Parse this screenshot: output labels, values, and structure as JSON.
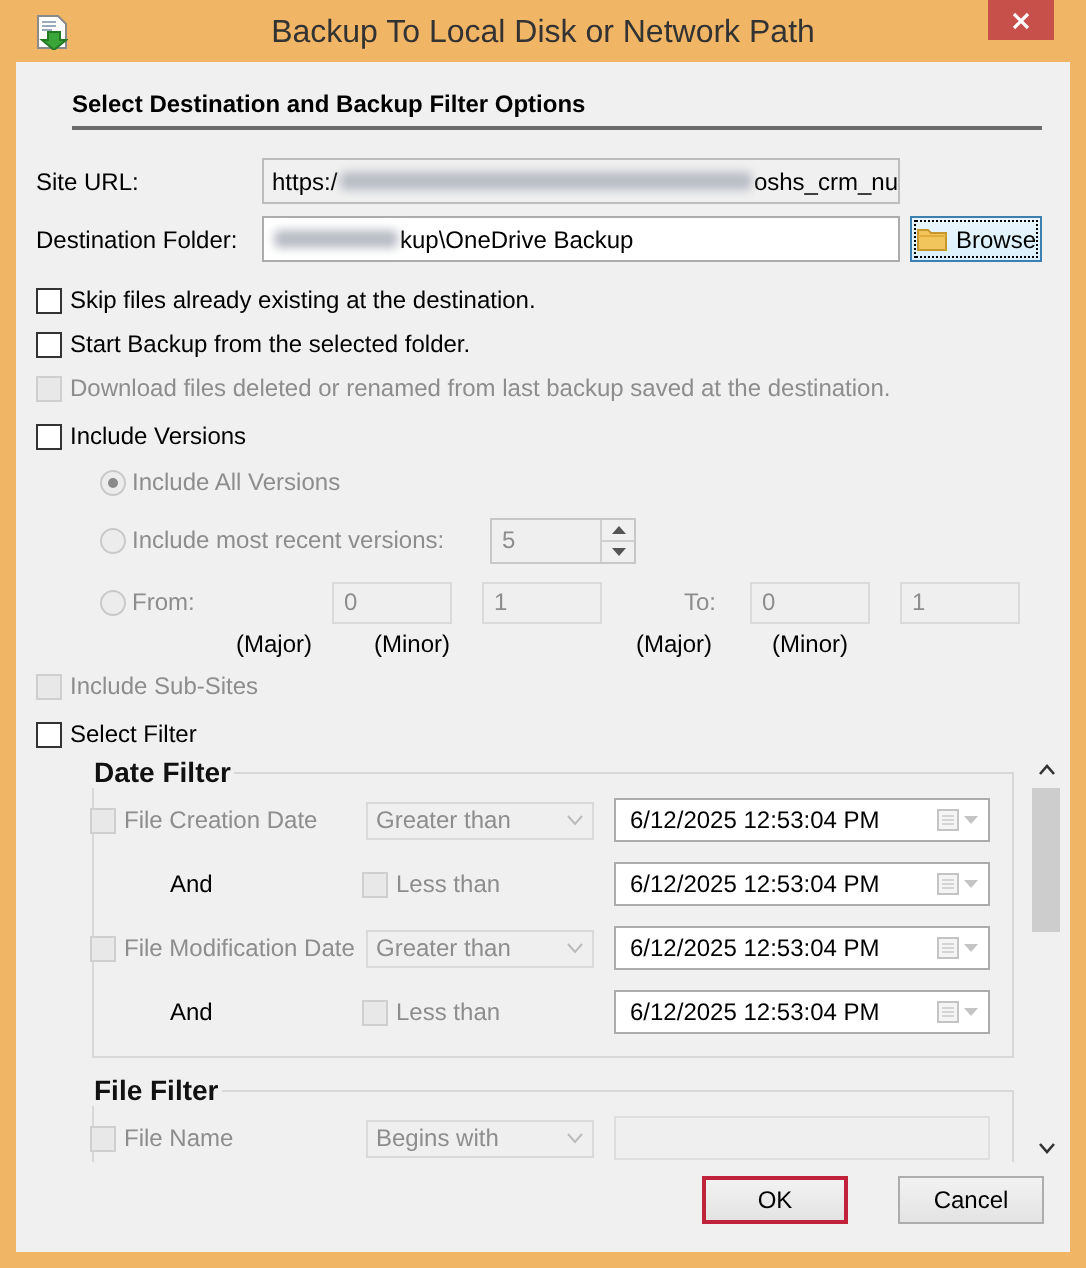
{
  "window": {
    "title": "Backup To Local Disk or Network Path"
  },
  "section_title": "Select Destination and Backup Filter Options",
  "fields": [
    {
      "label": "Site URL:",
      "value_start": "https:/",
      "redacted": true,
      "value_end": "oshs_crm_nu",
      "editable": false
    },
    {
      "label": "Destination Folder:",
      "redacted": true,
      "value_end": "kup\\OneDrive Backup",
      "editable": true
    }
  ],
  "browse_button": {
    "label": "Browse",
    "focused": true
  },
  "options": [
    {
      "label": "Skip files already existing at the destination.",
      "checked": false,
      "disabled": false
    },
    {
      "label": "Start Backup from the selected folder.",
      "checked": false,
      "disabled": false
    },
    {
      "label": "Download files deleted or renamed from last backup saved at the destination.",
      "checked": false,
      "disabled": true
    },
    {
      "label": "Include Versions",
      "checked": false,
      "disabled": false
    }
  ],
  "versions": [
    {
      "kind": "all",
      "label": "Include All Versions",
      "selected": true,
      "disabled": true
    },
    {
      "kind": "recent",
      "label": "Include most recent versions:",
      "selected": false,
      "disabled": true,
      "value": "5"
    },
    {
      "kind": "range",
      "label": "From:",
      "selected": false,
      "disabled": true,
      "from_major": "0",
      "from_minor": "1",
      "to_label": "To:",
      "to_major": "0",
      "to_minor": "1",
      "captions": [
        "(Major)",
        "(Minor)",
        "(Major)",
        "(Minor)"
      ]
    }
  ],
  "more_options": [
    {
      "label": "Include Sub-Sites",
      "checked": false,
      "disabled": true
    },
    {
      "label": "Select Filter",
      "checked": false,
      "disabled": false
    }
  ],
  "date_filter": {
    "title": "Date Filter",
    "rows": [
      {
        "label": "File Creation Date",
        "checked": false,
        "disabled": true,
        "operator": "Greater than",
        "from_date": "6/12/2025 12:53:04 PM",
        "and_label": "And",
        "less_than": {
          "label": "Less than",
          "checked": false,
          "disabled": true
        },
        "to_date": "6/12/2025 12:53:04 PM"
      },
      {
        "label": "File Modification Date",
        "checked": false,
        "disabled": true,
        "operator": "Greater than",
        "from_date": "6/12/2025 12:53:04 PM",
        "and_label": "And",
        "less_than": {
          "label": "Less than",
          "checked": false,
          "disabled": true
        },
        "to_date": "6/12/2025 12:53:04 PM"
      }
    ]
  },
  "file_filter": {
    "title": "File Filter",
    "rows": [
      {
        "label": "File Name",
        "checked": false,
        "disabled": true,
        "operator": "Begins with"
      }
    ]
  },
  "buttons": [
    {
      "label": "OK",
      "default": true
    },
    {
      "label": "Cancel",
      "default": false
    }
  ]
}
